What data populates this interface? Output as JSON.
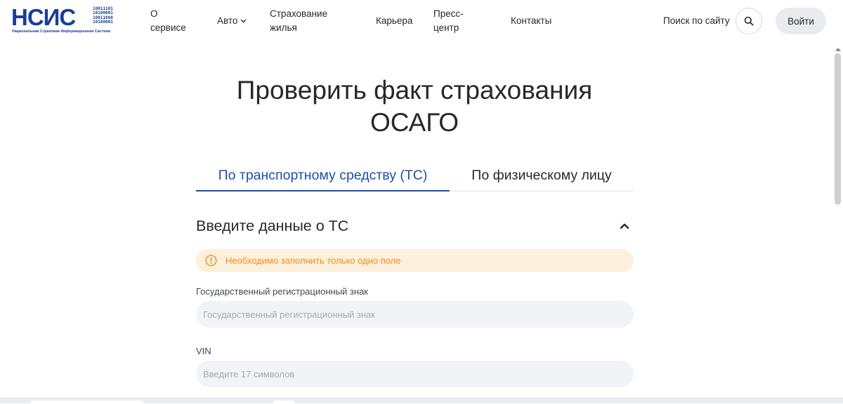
{
  "header": {
    "logo": {
      "letters": "НСИС",
      "bits": [
        "10011101",
        "10100001",
        "10011000",
        "10100001"
      ],
      "subtitle": "Национальная Страховая Информационная Система"
    },
    "nav": [
      {
        "label": "О сервисе"
      },
      {
        "label": "Авто"
      },
      {
        "label": "Страхование жилья"
      },
      {
        "label": "Карьера"
      },
      {
        "label": "Пресс-центр"
      },
      {
        "label": "Контакты"
      }
    ],
    "search_label": "Поиск по сайту",
    "login_label": "Войти"
  },
  "main": {
    "title_line1": "Проверить факт страхования",
    "title_line2": "ОСАГО",
    "tabs": [
      {
        "label": "По транспортному средству (ТС)",
        "active": true
      },
      {
        "label": "По физическому лицу",
        "active": false
      }
    ],
    "section_title": "Введите данные о ТС",
    "alert": "Необходимо заполнить только одно поле",
    "fields": [
      {
        "label": "Государственный регистрационный знак",
        "value": "",
        "placeholder": "Государственный регистрационный знак"
      },
      {
        "label": "VIN",
        "value": "",
        "placeholder": "Введите 17 символов"
      }
    ]
  },
  "colors": {
    "brand": "#1a3e96",
    "accent": "#1d4fa7",
    "alert_text": "#f28c18",
    "alert_bg": "#fdf0dd",
    "input_bg": "#f1f3f6"
  }
}
